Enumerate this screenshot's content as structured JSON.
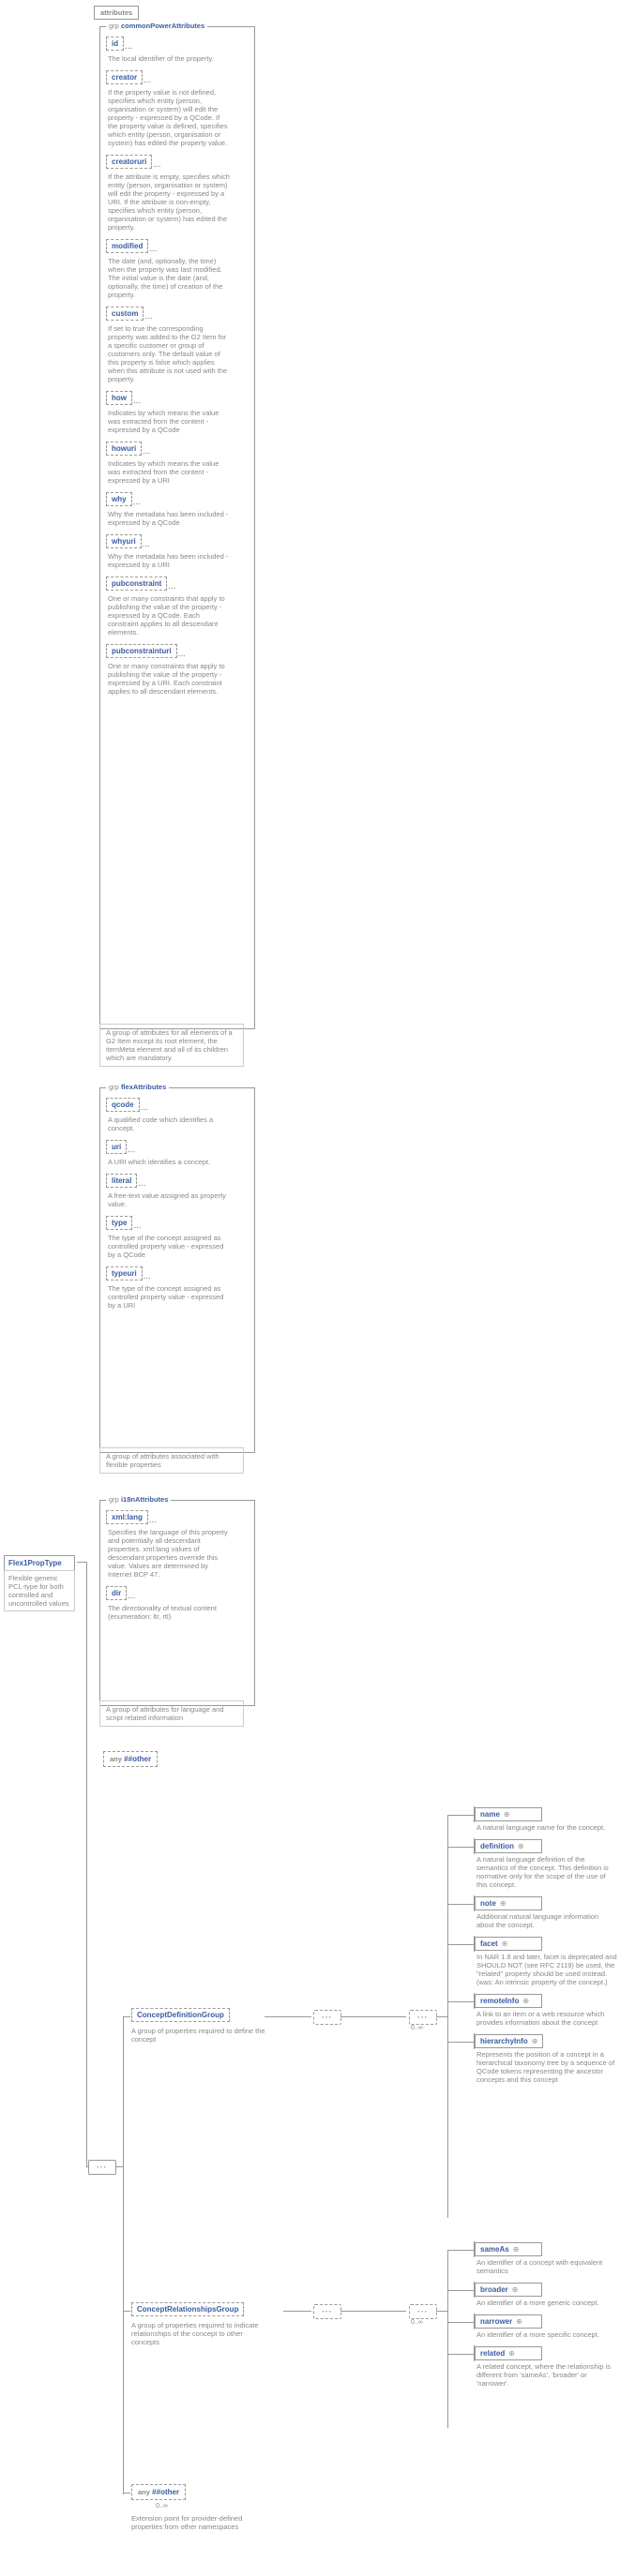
{
  "root": {
    "name": "Flex1PropType",
    "desc": "Flexible generic PCL-type for both controlled and uncontrolled values"
  },
  "attributes_label": "attributes",
  "grp_label": "grp",
  "common": {
    "title": "commonPowerAttributes",
    "items": [
      {
        "n": "id",
        "d": "The local identifier of the property."
      },
      {
        "n": "creator",
        "d": "If the property value is not defined, specifies which entity (person, organisation or system) will edit the property - expressed by a QCode. If the property value is defined, specifies which entity (person, organisation or system) has edited the property value."
      },
      {
        "n": "creatoruri",
        "d": "If the attribute is empty, specifies which entity (person, organisation or system) will edit the property - expressed by a URI. If the attribute is non-empty, specifies which entity (person, organisation or system) has edited the property."
      },
      {
        "n": "modified",
        "d": "The date (and, optionally, the time) when the property was last modified. The initial value is the date (and, optionally, the time) of creation of the property."
      },
      {
        "n": "custom",
        "d": "If set to true the corresponding property was added to the G2 Item for a specific customer or group of customers only. The default value of this property is false which applies when this attribute is not used with the property."
      },
      {
        "n": "how",
        "d": "Indicates by which means the value was extracted from the content - expressed by a QCode"
      },
      {
        "n": "howuri",
        "d": "Indicates by which means the value was extracted from the content - expressed by a URI"
      },
      {
        "n": "why",
        "d": "Why the metadata has been included - expressed by a QCode"
      },
      {
        "n": "whyuri",
        "d": "Why the metadata has been included - expressed by a URI"
      },
      {
        "n": "pubconstraint",
        "d": "One or many constraints that apply to publishing the value of the property - expressed by a QCode. Each constraint applies to all descendant elements."
      },
      {
        "n": "pubconstrainturi",
        "d": "One or many constraints that apply to publishing the value of the property - expressed by a URI. Each constraint applies to all descendant elements."
      }
    ],
    "desc": "A group of attributes for all elements of a G2 Item except its root element, the itemMeta element and all of its children which are mandatory."
  },
  "flex": {
    "title": "flexAttributes",
    "items": [
      {
        "n": "qcode",
        "d": "A qualified code which identifies a concept."
      },
      {
        "n": "uri",
        "d": "A URI which identifies a concept."
      },
      {
        "n": "literal",
        "d": "A free-text value assigned as property value."
      },
      {
        "n": "type",
        "d": "The type of the concept assigned as controlled property value - expressed by a QCode"
      },
      {
        "n": "typeuri",
        "d": "The type of the concept assigned as controlled property value - expressed by a URI"
      }
    ],
    "desc": "A group of attributes associated with flexible properties"
  },
  "i18n": {
    "title": "i18nAttributes",
    "items": [
      {
        "n": "xml:lang",
        "d": "Specifies the language of this property and potentially all descendant properties. xml:lang values of descendant properties override this value. Values are determined by Internet BCP 47."
      },
      {
        "n": "dir",
        "d": "The directionality of textual content (enumeration: ltr, rtl)"
      }
    ],
    "desc": "A group of attributes for language and script related information"
  },
  "any_label": "any",
  "any_other_label": "##other",
  "conceptDef": {
    "title": "ConceptDefinitionGroup",
    "desc": "A group of properties required to define the concept"
  },
  "conceptRel": {
    "title": "ConceptRelationshipsGroup",
    "desc": "A group of properties required to indicate relationships of the concept to other concepts"
  },
  "ext_other": {
    "desc": "Extension point for provider-defined properties from other namespaces"
  },
  "def_children": [
    {
      "n": "name",
      "d": "A natural language name for the concept."
    },
    {
      "n": "definition",
      "d": "A natural language definition of the semantics of the concept. This definition is normative only for the scope of the use of this concept."
    },
    {
      "n": "note",
      "d": "Additional natural language information about the concept."
    },
    {
      "n": "facet",
      "d": "In NAR 1.8 and later, facet is deprecated and SHOULD NOT (see RFC 2119) be used, the \"related\" property should be used instead. (was: An intrinsic property of the concept.)"
    },
    {
      "n": "remoteInfo",
      "d": "A link to an item or a web resource which provides information about the concept"
    },
    {
      "n": "hierarchyInfo",
      "d": "Represents the position of a concept in a hierarchical taxonomy tree by a sequence of QCode tokens representing the ancestor concepts and this concept"
    }
  ],
  "rel_children": [
    {
      "n": "sameAs",
      "d": "An identifier of a concept with equivalent semantics"
    },
    {
      "n": "broader",
      "d": "An identifier of a more generic concept."
    },
    {
      "n": "narrower",
      "d": "An identifier of a more specific concept."
    },
    {
      "n": "related",
      "d": "A related concept, where the relationship is different from 'sameAs', 'broader' or 'narrower'."
    }
  ],
  "range_inf": "0..∞"
}
